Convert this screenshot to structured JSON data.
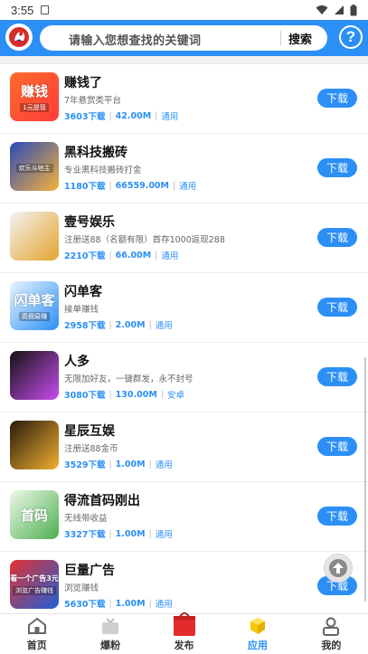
{
  "status_bar": {
    "time": "3:55"
  },
  "header": {
    "search_placeholder": "请输入您想查找的关键词",
    "search_button": "搜索",
    "help_glyph": "?"
  },
  "download_label": "下载",
  "apps": [
    {
      "name": "赚钱了",
      "desc": "7年悬赏类平台",
      "downloads": "3603下载",
      "size": "42.00M",
      "tag": "通用",
      "thumb_text": "赚钱",
      "thumb_sub": "1元提现",
      "colors": [
        "#ff6b2b",
        "#ff3b3b"
      ]
    },
    {
      "name": "黑科技搬砖",
      "desc": "专业黑科技搬砖打金",
      "downloads": "1180下载",
      "size": "66559.00M",
      "tag": "通用",
      "thumb_text": "",
      "thumb_sub": "欢乐斗地主",
      "colors": [
        "#2a4bb8",
        "#f6b13b"
      ]
    },
    {
      "name": "壹号娱乐",
      "desc": "注册送88（名额有限）首存1000返现288",
      "downloads": "2210下载",
      "size": "66.00M",
      "tag": "通用",
      "thumb_text": "",
      "thumb_sub": "",
      "colors": [
        "#f3f3f3",
        "#e4a32c"
      ]
    },
    {
      "name": "闪单客",
      "desc": "接单赚钱",
      "downloads": "2958下载",
      "size": "2.00M",
      "tag": "通用",
      "thumb_text": "闪单客",
      "thumb_sub": "高佣易赚",
      "colors": [
        "#e8f4ff",
        "#2b8ff5"
      ]
    },
    {
      "name": "人多",
      "desc": "无限加好友，一键群发，永不封号",
      "downloads": "3080下载",
      "size": "130.00M",
      "tag": "安卓",
      "thumb_text": "",
      "thumb_sub": "",
      "colors": [
        "#111111",
        "#c94cf0"
      ]
    },
    {
      "name": "星辰互娱",
      "desc": "注册送88金币",
      "downloads": "3529下载",
      "size": "1.00M",
      "tag": "通用",
      "thumb_text": "",
      "thumb_sub": "",
      "colors": [
        "#2a1a0a",
        "#f0b030"
      ]
    },
    {
      "name": "得流首码刚出",
      "desc": "无线带收益",
      "downloads": "3327下载",
      "size": "1.00M",
      "tag": "通用",
      "thumb_text": "首码",
      "thumb_sub": "",
      "colors": [
        "#eef8e8",
        "#4caf50"
      ]
    },
    {
      "name": "巨量广告",
      "desc": "浏览赚钱",
      "downloads": "5630下载",
      "size": "1.00M",
      "tag": "通用",
      "thumb_text": "看一个广告3元",
      "thumb_sub": "浏览广告赚钱",
      "colors": [
        "#e33131",
        "#1f5fd6"
      ]
    }
  ],
  "nav": [
    {
      "label": "首页",
      "icon": "home-icon",
      "active": false
    },
    {
      "label": "爆粉",
      "icon": "tv-icon",
      "active": false
    },
    {
      "label": "发布",
      "icon": "publish-icon",
      "active": false
    },
    {
      "label": "应用",
      "icon": "apps-cube-icon",
      "active": true
    },
    {
      "label": "我的",
      "icon": "user-icon",
      "active": false
    }
  ],
  "colors": {
    "primary": "#2b8ff5",
    "active_nav": "#2b8ff5"
  }
}
